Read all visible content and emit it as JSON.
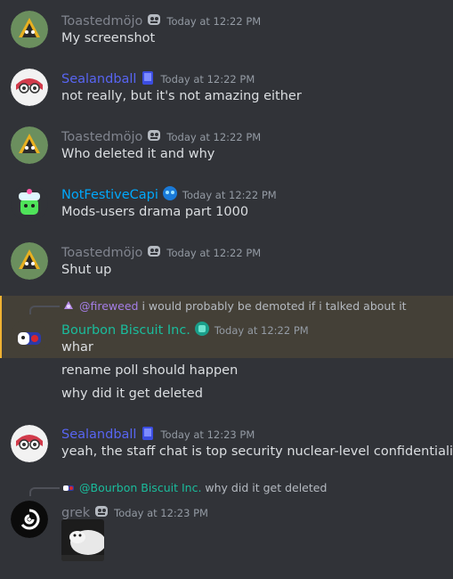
{
  "colors": {
    "background": "#313338",
    "highlight": "#444037",
    "text": "#dbdee1",
    "timestamp": "#949ba4",
    "toastedmojo": "#80848e",
    "sealandball": "#5865f2",
    "notfestivecapi": "#00a8fc",
    "bourbon": "#1abc9c",
    "grek": "#80848e",
    "fireweed_mention": "#a57ee6"
  },
  "messages": [
    {
      "author": "Toastedmöjo",
      "timestamp": "Today at 12:22 PM",
      "lines": [
        "My screenshot"
      ]
    },
    {
      "author": "Sealandball",
      "timestamp": "Today at 12:22 PM",
      "lines": [
        "not really, but it's not amazing either"
      ]
    },
    {
      "author": "Toastedmöjo",
      "timestamp": "Today at 12:22 PM",
      "lines": [
        "Who deleted it and why"
      ]
    },
    {
      "author": "NotFestiveCapi",
      "timestamp": "Today at 12:22 PM",
      "lines": [
        "Mods-users drama part 1000"
      ]
    },
    {
      "author": "Toastedmöjo",
      "timestamp": "Today at 12:22 PM",
      "lines": [
        "Shut up"
      ]
    },
    {
      "author": "Bourbon Biscuit Inc.",
      "timestamp": "Today at 12:22 PM",
      "reply": {
        "mention": "@fireweed",
        "text": "i would probably be demoted if i talked about it"
      },
      "lines": [
        "whar",
        "rename poll should happen",
        "why did it get deleted"
      ]
    },
    {
      "author": "Sealandball",
      "timestamp": "Today at 12:23 PM",
      "lines": [
        "yeah, the staff chat is top security nuclear-level confidentiality"
      ]
    },
    {
      "author": "grek",
      "timestamp": "Today at 12:23 PM",
      "reply": {
        "mention": "@Bourbon Biscuit Inc.",
        "text": "why did it get deleted"
      },
      "lines": []
    }
  ]
}
